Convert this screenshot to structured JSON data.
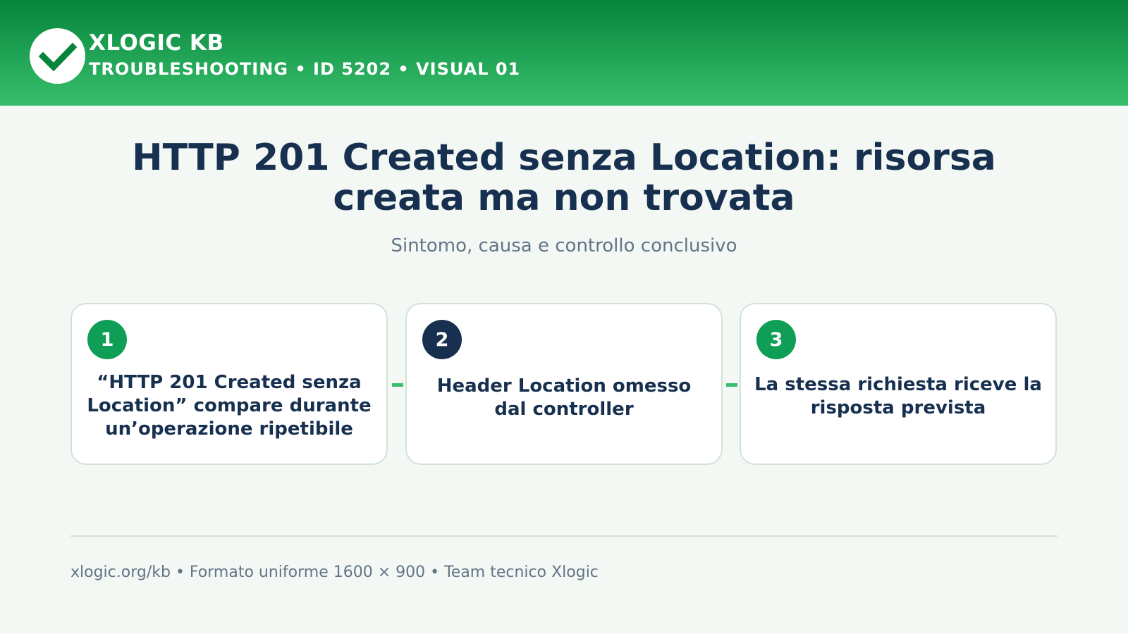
{
  "header": {
    "brand": "XLOGIC KB",
    "subtitle": "TROUBLESHOOTING • ID 5202 • VISUAL 01",
    "logo_icon": "check-icon",
    "gradient_top": "#07843b",
    "gradient_bottom": "#37bf6c"
  },
  "main": {
    "title": "HTTP 201 Created senza Location: risorsa creata ma non trovata",
    "subtitle": "Sintomo, causa e controllo conclusivo"
  },
  "steps": [
    {
      "number": "1",
      "text": "“HTTP 201 Created senza Location” compare durante un’operazione ripetibile",
      "badge_color": "#0f9e55"
    },
    {
      "number": "2",
      "text": "Header Location omesso dal controller",
      "badge_color": "#17304f"
    },
    {
      "number": "3",
      "text": "La stessa richiesta riceve la risposta prevista",
      "badge_color": "#0f9e55"
    }
  ],
  "footer": {
    "text": "xlogic.org/kb • Formato uniforme 1600 × 900 • Team tecnico Xlogic"
  },
  "colors": {
    "title": "#17304f",
    "muted": "#627586",
    "accent": "#37bf6c",
    "card_border": "#d1e3d9",
    "background": "#f4f8f5"
  }
}
